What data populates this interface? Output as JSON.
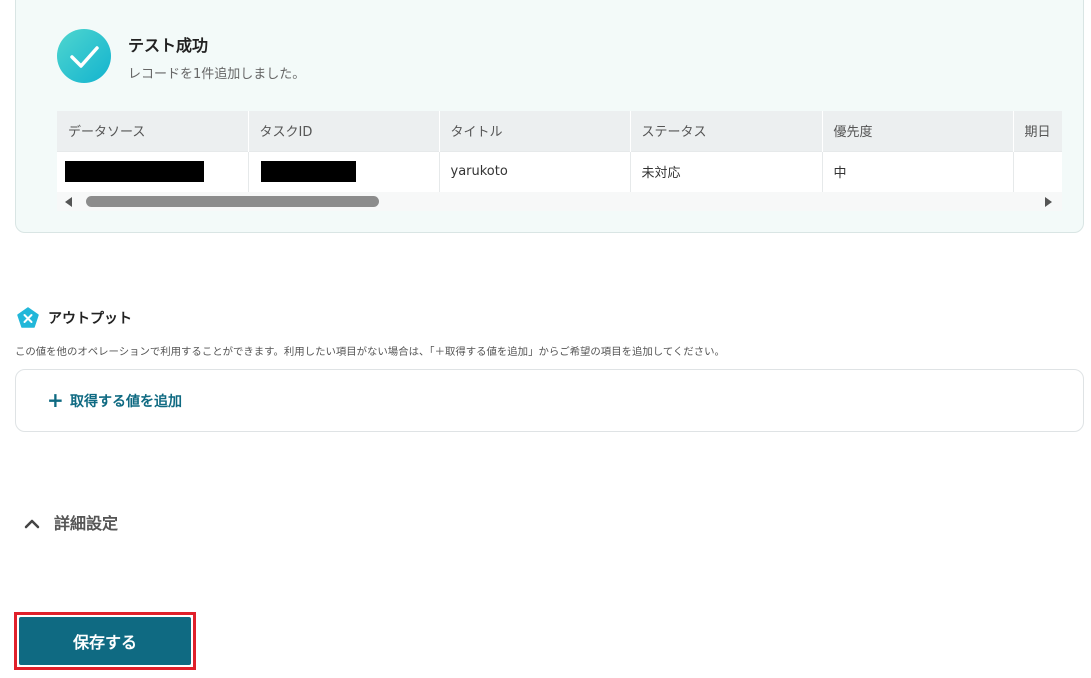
{
  "result": {
    "title": "テスト成功",
    "subtitle": "レコードを1件追加しました。"
  },
  "table": {
    "columns": [
      "データソース",
      "タスクID",
      "タイトル",
      "ステータス",
      "優先度",
      "期日"
    ],
    "rows": [
      {
        "data_source": "",
        "task_id": "",
        "title": "yarukoto",
        "status": "未対応",
        "priority": "中",
        "due": ""
      }
    ]
  },
  "output": {
    "title": "アウトプット",
    "description": "この値を他のオペレーションで利用することができます。利用したい項目がない場合は、「＋取得する値を追加」からご希望の項目を追加してください。",
    "add_plus": "+",
    "add_label": "取得する値を追加"
  },
  "advanced": {
    "label": "詳細設定"
  },
  "save": {
    "label": "保存する"
  },
  "colors": {
    "primary": "#0f6a82",
    "success_start": "#4fd6cf",
    "success_end": "#13b3cf",
    "highlight": "#e0202a"
  }
}
